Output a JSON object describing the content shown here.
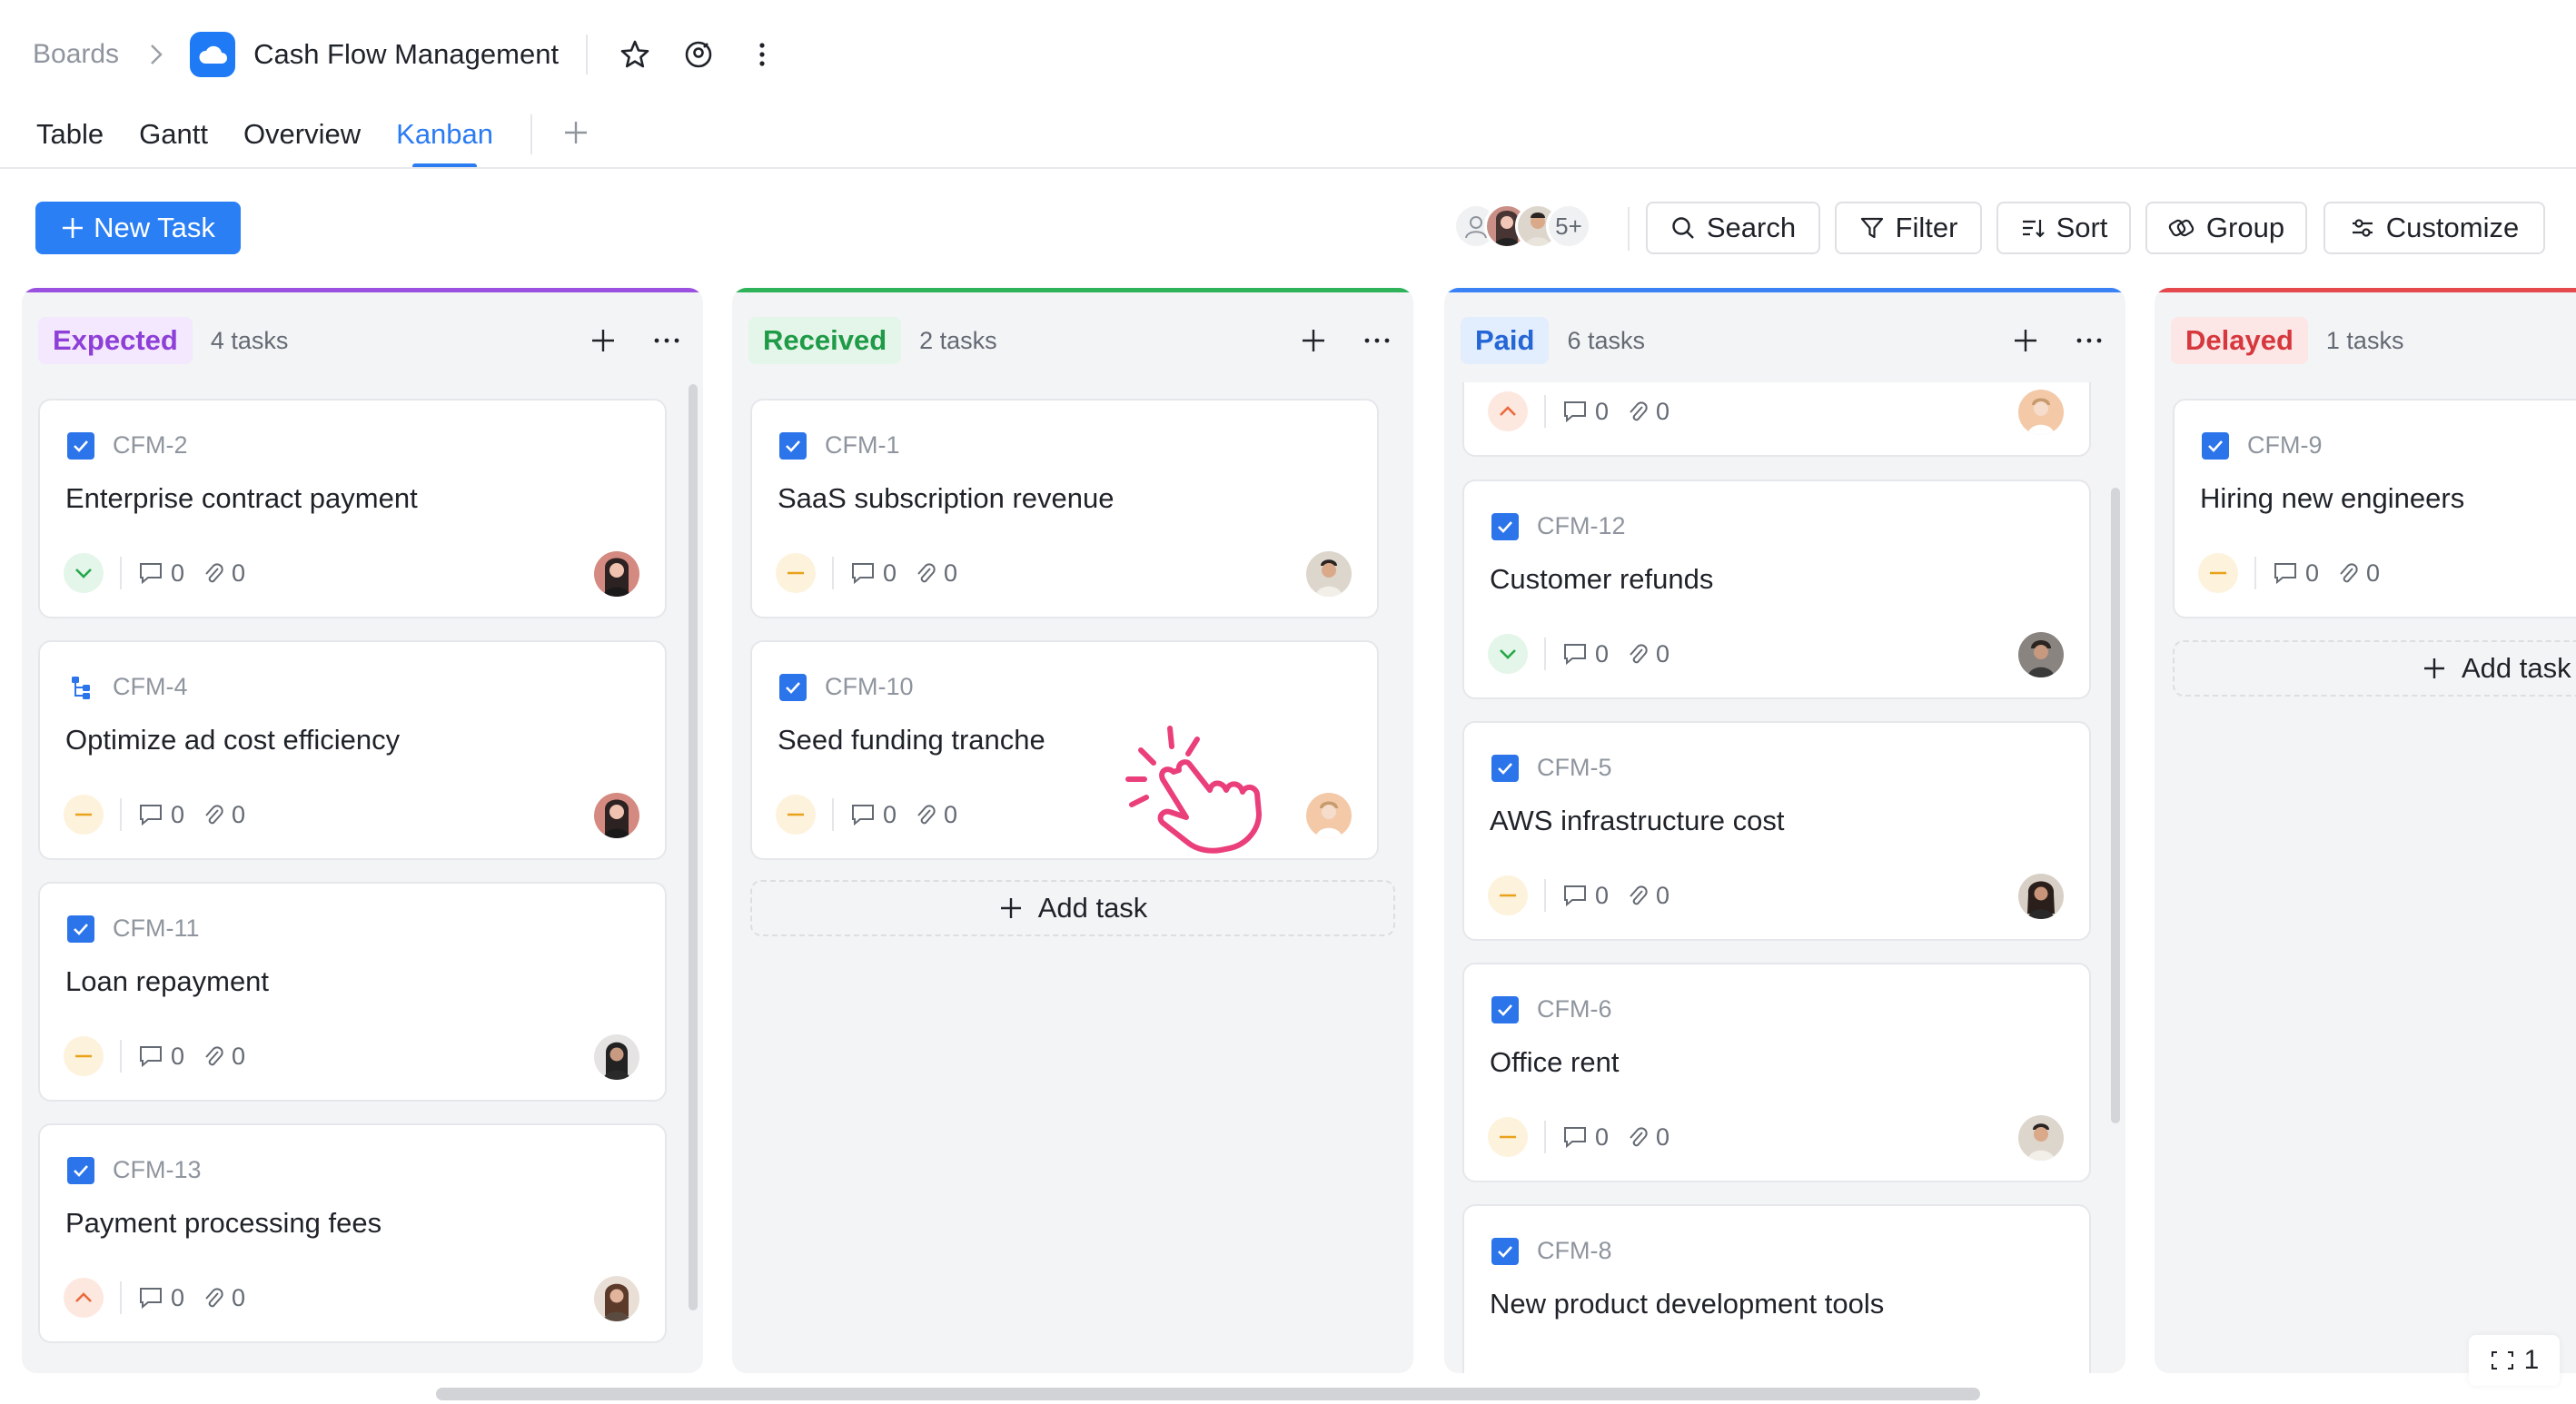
{
  "header": {
    "breadcrumb_root": "Boards",
    "board_title": "Cash Flow Management",
    "icons": [
      "chevron-right-icon",
      "cloud-icon",
      "star-icon",
      "at-user-icon",
      "more-vertical-icon"
    ]
  },
  "tabs": [
    {
      "label": "Table",
      "active": false
    },
    {
      "label": "Gantt",
      "active": false
    },
    {
      "label": "Overview",
      "active": false
    },
    {
      "label": "Kanban",
      "active": true
    }
  ],
  "toolbar": {
    "new_task_label": "New Task",
    "avatars_more": "5+",
    "search_label": "Search",
    "filter_label": "Filter",
    "sort_label": "Sort",
    "group_label": "Group",
    "customize_label": "Customize"
  },
  "columns": [
    {
      "name": "Expected",
      "count": "4 tasks",
      "color": "#9b51e0",
      "pill_bg": "#f3e8fd",
      "pill_fg": "#8e3fd8",
      "cards": [
        {
          "id": "CFM-2",
          "title": "Enterprise contract payment",
          "priority": "low",
          "comments": "0",
          "attachments": "0",
          "icon": "checkbox-icon"
        },
        {
          "id": "CFM-4",
          "title": "Optimize ad cost efficiency",
          "priority": "medium",
          "comments": "0",
          "attachments": "0",
          "icon": "subtask-icon"
        },
        {
          "id": "CFM-11",
          "title": "Loan repayment",
          "priority": "medium",
          "comments": "0",
          "attachments": "0",
          "icon": "checkbox-icon"
        },
        {
          "id": "CFM-13",
          "title": "Payment processing fees",
          "priority": "high",
          "comments": "0",
          "attachments": "0",
          "icon": "checkbox-icon"
        }
      ]
    },
    {
      "name": "Received",
      "count": "2 tasks",
      "color": "#2fb35a",
      "pill_bg": "#e3f6e9",
      "pill_fg": "#1f9a47",
      "cards": [
        {
          "id": "CFM-1",
          "title": "SaaS subscription revenue",
          "priority": "medium",
          "comments": "0",
          "attachments": "0",
          "icon": "checkbox-icon"
        },
        {
          "id": "CFM-10",
          "title": "Seed funding tranche",
          "priority": "medium",
          "comments": "0",
          "attachments": "0",
          "icon": "checkbox-icon"
        }
      ],
      "add_task_label": "Add task"
    },
    {
      "name": "Paid",
      "count": "6 tasks",
      "color": "#3b82f6",
      "pill_bg": "#e2edfd",
      "pill_fg": "#2466d6",
      "cards": [
        {
          "id": "",
          "title": "",
          "priority": "high",
          "comments": "0",
          "attachments": "0",
          "icon": ""
        },
        {
          "id": "CFM-12",
          "title": "Customer refunds",
          "priority": "low",
          "comments": "0",
          "attachments": "0",
          "icon": "checkbox-icon"
        },
        {
          "id": "CFM-5",
          "title": "AWS infrastructure cost",
          "priority": "medium",
          "comments": "0",
          "attachments": "0",
          "icon": "checkbox-icon"
        },
        {
          "id": "CFM-6",
          "title": "Office rent",
          "priority": "medium",
          "comments": "0",
          "attachments": "0",
          "icon": "checkbox-icon"
        },
        {
          "id": "CFM-8",
          "title": "New product development tools",
          "priority": "",
          "comments": "",
          "attachments": "",
          "icon": "checkbox-icon"
        }
      ]
    },
    {
      "name": "Delayed",
      "count": "1 tasks",
      "color": "#e5484d",
      "pill_bg": "#fde6e6",
      "pill_fg": "#d6383e",
      "cards": [
        {
          "id": "CFM-9",
          "title": "Hiring new engineers",
          "priority": "medium",
          "comments": "0",
          "attachments": "0",
          "icon": "checkbox-icon"
        }
      ],
      "add_task_label": "Add task"
    }
  ],
  "page_indicator": "1"
}
